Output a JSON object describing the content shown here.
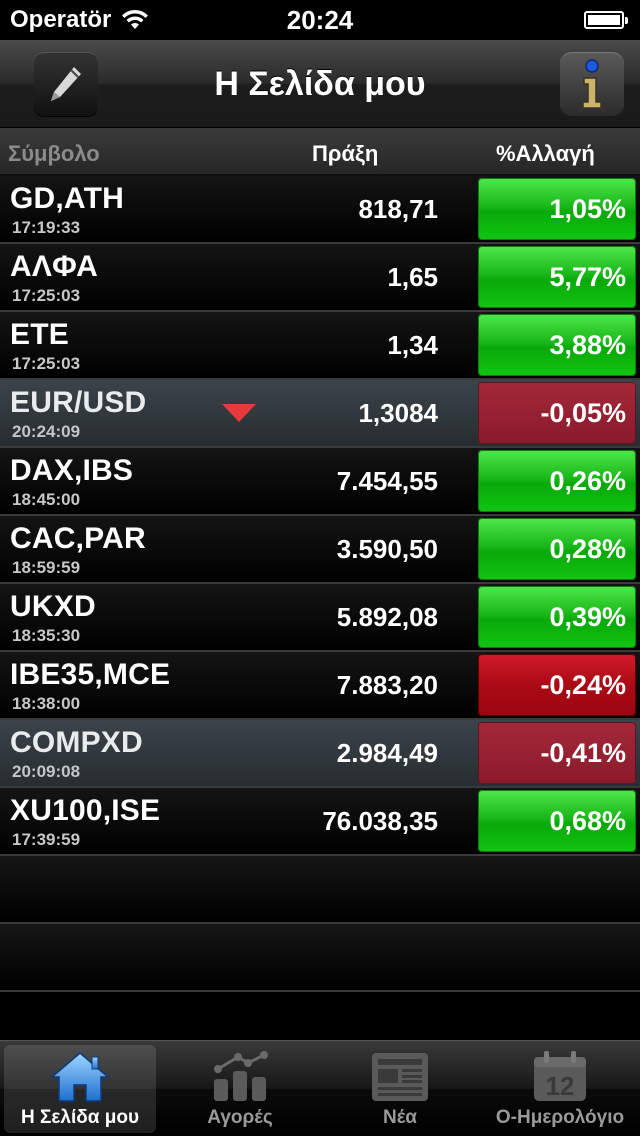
{
  "status": {
    "carrier": "Operatör",
    "time": "20:24"
  },
  "nav": {
    "title": "Η Σελίδα μου"
  },
  "columns": {
    "symbol": "Σύμβολο",
    "trade": "Πράξη",
    "change": "%Αλλαγή"
  },
  "rows": [
    {
      "symbol": "GD,ATH",
      "time": "17:19:33",
      "trade": "818,71",
      "change": "1,05%"
    },
    {
      "symbol": "ΑΛΦΑ",
      "time": "17:25:03",
      "trade": "1,65",
      "change": "5,77%"
    },
    {
      "symbol": "ETE",
      "time": "17:25:03",
      "trade": "1,34",
      "change": "3,88%"
    },
    {
      "symbol": "EUR/USD",
      "time": "20:24:09",
      "trade": "1,3084",
      "change": "-0,05%"
    },
    {
      "symbol": "DAX,IBS",
      "time": "18:45:00",
      "trade": "7.454,55",
      "change": "0,26%"
    },
    {
      "symbol": "CAC,PAR",
      "time": "18:59:59",
      "trade": "3.590,50",
      "change": "0,28%"
    },
    {
      "symbol": "UKXD",
      "time": "18:35:30",
      "trade": "5.892,08",
      "change": "0,39%"
    },
    {
      "symbol": "IBE35,MCE",
      "time": "18:38:00",
      "trade": "7.883,20",
      "change": "-0,24%"
    },
    {
      "symbol": "COMPXD",
      "time": "20:09:08",
      "trade": "2.984,49",
      "change": "-0,41%"
    },
    {
      "symbol": "XU100,ISE",
      "time": "17:39:59",
      "trade": "76.038,35",
      "change": "0,68%"
    }
  ],
  "tabs": {
    "home": "Η Σελίδα μου",
    "markets": "Αγορές",
    "news": "Νέα",
    "calendar": "Ο-Ημερολόγιο",
    "calendar_day": "12"
  },
  "colors": {
    "up": "#12c411",
    "down": "#aa0a15",
    "tab_active": "#4aa3e8"
  }
}
